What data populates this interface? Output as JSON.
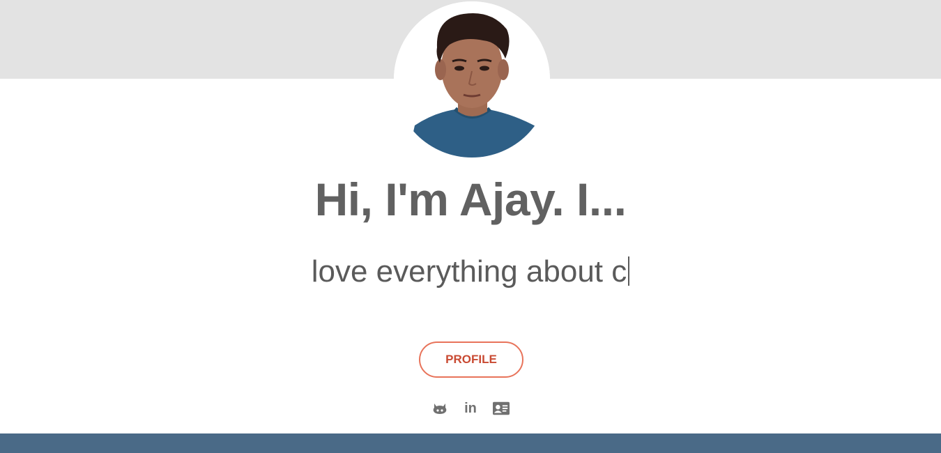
{
  "hero": {
    "headline": "Hi, I'm Ajay. I...",
    "typed_text": "love everything about c",
    "avatar_alt": "profile-photo"
  },
  "actions": {
    "profile_label": "PROFILE"
  },
  "social": {
    "linkedin_text": "in",
    "icons": [
      "github-icon",
      "linkedin-icon",
      "contact-card-icon"
    ]
  },
  "colors": {
    "top_band": "#e3e3e3",
    "bottom_band": "#4a6a87",
    "accent": "#e8735a",
    "accent_text": "#c94a32",
    "text": "#616161"
  }
}
